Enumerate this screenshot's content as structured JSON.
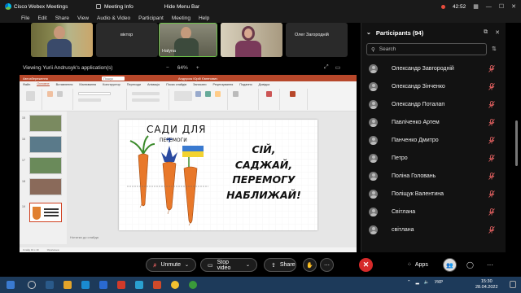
{
  "titlebar": {
    "app_name": "Cisco Webex Meetings",
    "meeting_info": "Meeting Info",
    "hide_menu_bar": "Hide Menu Bar",
    "timer": "42:52"
  },
  "menubar": {
    "items": [
      "File",
      "Edit",
      "Share",
      "View",
      "Audio & Video",
      "Participant",
      "Meeting",
      "Help"
    ]
  },
  "video_tiles": [
    {
      "name": ""
    },
    {
      "name": "віктор"
    },
    {
      "name": "Halyna"
    },
    {
      "name": ""
    },
    {
      "name": "Олег Загородній"
    }
  ],
  "share_bar": {
    "viewing_text": "Viewing Yurii Andrusyk's application(s)",
    "zoom_out": "−",
    "zoom_level": "64%",
    "zoom_in": "+"
  },
  "powerpoint": {
    "autosave": "Автозбереження",
    "file_name": "Андрусик Юрій Євгенович",
    "search_placeholder": "Пошук",
    "tabs": [
      "Файл",
      "Основне",
      "Вставлення",
      "Малювання",
      "Конструктор",
      "Переходи",
      "Анімація",
      "Показ слайдів",
      "Записати",
      "Рецензування",
      "Подання",
      "Довідка"
    ],
    "active_tab": "Основне",
    "thumb_numbers": [
      "15",
      "16",
      "17",
      "18",
      "19"
    ],
    "slide_heading": "САДИ ДЛЯ",
    "slide_subheading": "ПЕРЕМОГИ",
    "slide_lines": [
      "СІЙ,",
      "САДЖАЙ,",
      "ПЕРЕМОГУ",
      "НАБЛИЖАЙ!"
    ],
    "notes_placeholder": "Нотатки до слайда",
    "status_text": "Слайд 19 з 19",
    "status_lang": "Українська"
  },
  "participants_panel": {
    "title": "Participants (94)",
    "search_placeholder": "Search",
    "participants": [
      "Олександр Завгородній",
      "Олександр Зінченко",
      "Олександр Поталап",
      "Павліченко Артем",
      "Панченко Дмитро",
      "Петро",
      "Поліна Головань",
      "Поліщук Валентина",
      "Світлана",
      "світлана"
    ]
  },
  "controls": {
    "unmute": "Unmute",
    "stop_video": "Stop video",
    "share": "Share",
    "apps": "Apps"
  },
  "taskbar": {
    "language": "УКР",
    "time": "15:30",
    "date": "28.04.2022"
  },
  "colors": {
    "powerpoint_red": "#b7472a",
    "end_call": "#d62a2a",
    "muted_mic": "#e06060"
  }
}
